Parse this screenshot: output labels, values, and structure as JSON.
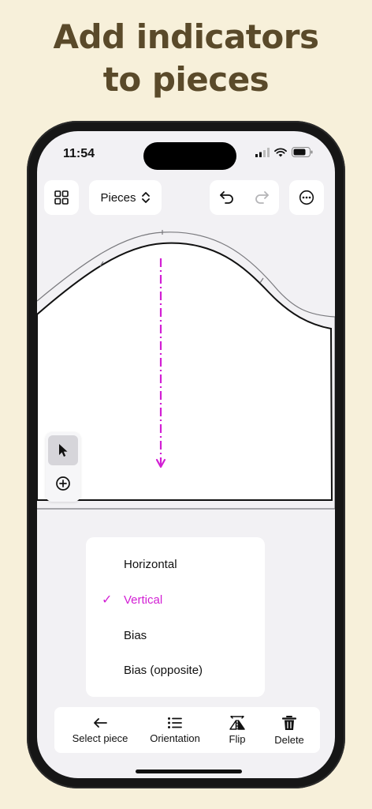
{
  "headline": {
    "line1": "Add indicators",
    "line2": "to pieces"
  },
  "status_bar": {
    "time": "11:54"
  },
  "toolbar": {
    "pieces_label": "Pieces"
  },
  "menu": {
    "items": [
      {
        "label": "Horizontal",
        "selected": false
      },
      {
        "label": "Vertical",
        "selected": true
      },
      {
        "label": "Bias",
        "selected": false
      },
      {
        "label": "Bias (opposite)",
        "selected": false
      }
    ]
  },
  "bottom_bar": {
    "items": [
      {
        "label": "Select piece",
        "icon": "arrow-left-icon"
      },
      {
        "label": "Orientation",
        "icon": "list-icon"
      },
      {
        "label": "Flip",
        "icon": "flip-icon"
      },
      {
        "label": "Delete",
        "icon": "trash-icon"
      }
    ]
  },
  "colors": {
    "background": "#f7f0da",
    "headline": "#5a4a2a",
    "accent": "#d21fd4",
    "screen": "#f2f1f4"
  }
}
